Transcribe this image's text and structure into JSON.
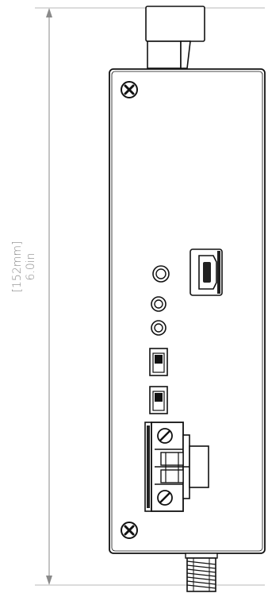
{
  "dimension": {
    "metric": "[152mm]",
    "imperial": "6.0in"
  },
  "colors": {
    "line": "#111111",
    "dimension": "#8a8a8a",
    "fill": "#ffffff",
    "port_dark": "#222222"
  },
  "icons": {
    "top_screw": "phillips-screw-icon",
    "bottom_screw": "phillips-screw-icon"
  }
}
